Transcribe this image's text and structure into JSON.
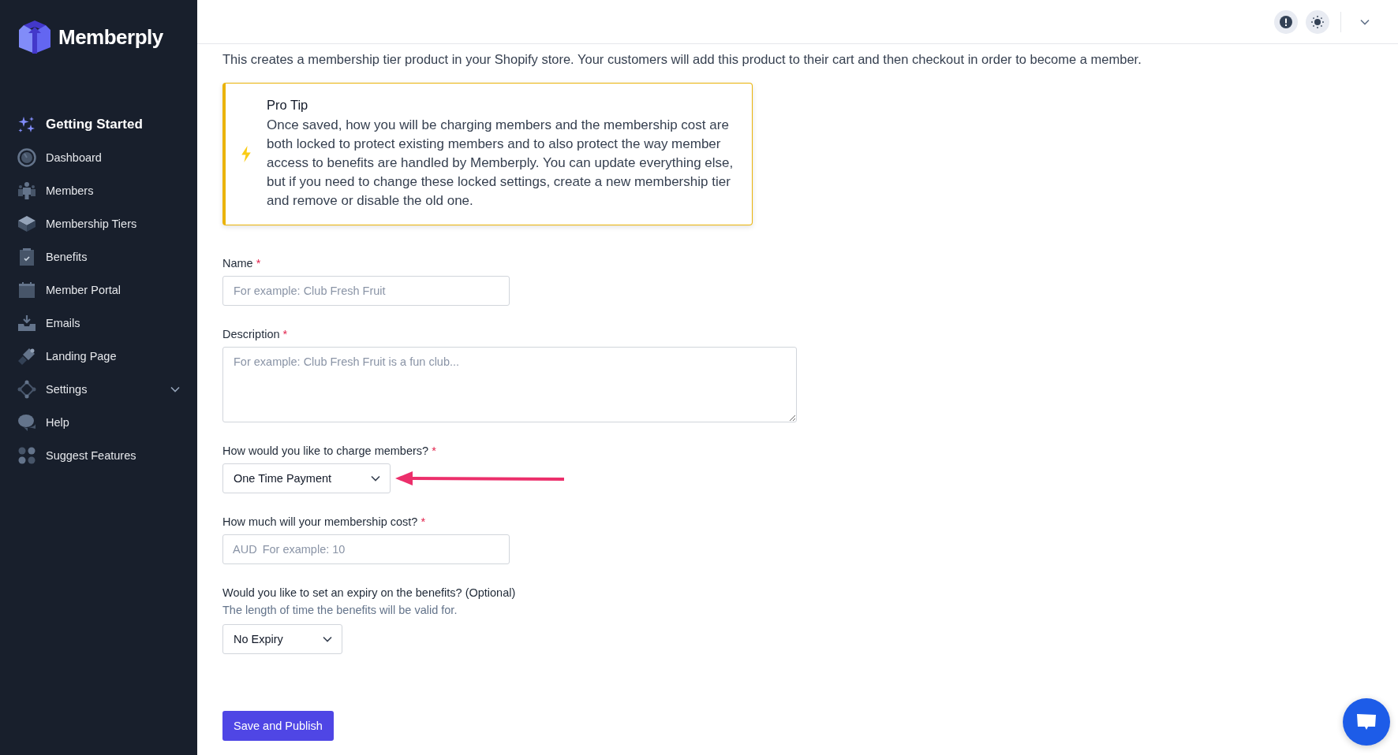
{
  "sidebar": {
    "brand": "Memberply",
    "items": [
      {
        "label": "Getting Started",
        "kind": "featured"
      },
      {
        "label": "Dashboard",
        "kind": "link"
      },
      {
        "label": "Members",
        "kind": "link"
      },
      {
        "label": "Membership Tiers",
        "kind": "link"
      },
      {
        "label": "Benefits",
        "kind": "link"
      },
      {
        "label": "Member Portal",
        "kind": "link"
      },
      {
        "label": "Emails",
        "kind": "link"
      },
      {
        "label": "Landing Page",
        "kind": "link"
      },
      {
        "label": "Settings",
        "kind": "group"
      },
      {
        "label": "Help",
        "kind": "link"
      },
      {
        "label": "Suggest Features",
        "kind": "link"
      }
    ]
  },
  "page": {
    "intro": "This creates a membership tier product in your Shopify store. Your customers will add this product to their cart and then checkout in order to become a member."
  },
  "tip": {
    "title": "Pro Tip",
    "body": "Once saved, how you will be charging members and the membership cost are both locked to protect existing members and to also protect the way member access to benefits are handled by Memberply. You can update everything else, but if you need to change these locked settings, create a new membership tier and remove or disable the old one."
  },
  "fields": [
    {
      "kind": "text",
      "label": "Name",
      "required_mark": "*",
      "placeholder": "For example: Club Fresh Fruit"
    },
    {
      "kind": "textarea",
      "label": "Description",
      "required_mark": "*",
      "placeholder": "For example: Club Fresh Fruit is a fun club..."
    },
    {
      "kind": "select",
      "label": "How would you like to charge members?",
      "required_mark": "*",
      "value": "One Time Payment",
      "annotated": true
    },
    {
      "kind": "money",
      "label": "How much will your membership cost?",
      "required_mark": "*",
      "prefix": "AUD",
      "placeholder": "For example: 10"
    },
    {
      "kind": "select",
      "label": "Would you like to set an expiry on the benefits? (Optional)",
      "help": "The length of time the benefits will be valid for.",
      "value": "No Expiry",
      "annotated": false
    }
  ],
  "submit": "Save and Publish"
}
